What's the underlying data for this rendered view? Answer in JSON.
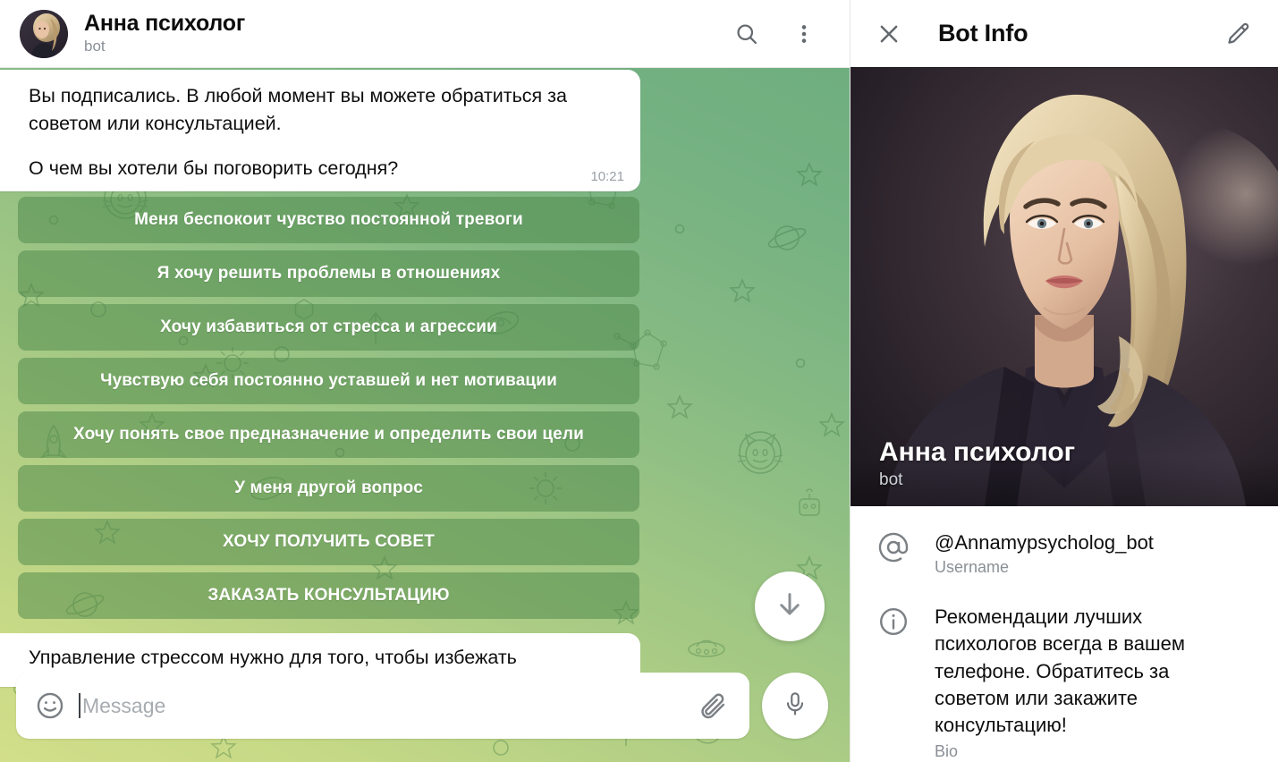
{
  "chat_header": {
    "title": "Анна психолог",
    "subtitle": "bot",
    "avatar_name": "anna-psycholog-avatar",
    "search_icon": "search-icon",
    "menu_icon": "more-vertical-icon"
  },
  "message": {
    "paragraph_1": "Вы подписались. В любой момент вы можете обратиться за советом или консультацией.",
    "paragraph_2": "О чем вы хотели бы поговорить сегодня?",
    "time": "10:21"
  },
  "keyboard": {
    "buttons": [
      {
        "label": "Меня беспокоит чувство постоянной тревоги"
      },
      {
        "label": "Я хочу решить проблемы в отношениях"
      },
      {
        "label": "Хочу избавиться от стресса и агрессии"
      },
      {
        "label": "Чувствую себя постоянно уставшей и нет мотивации"
      },
      {
        "label": "Хочу понять свое предназначение и определить свои цели"
      },
      {
        "label": "У меня другой вопрос"
      },
      {
        "label": "ХОЧУ ПОЛУЧИТЬ СОВЕТ"
      },
      {
        "label": "ЗАКАЗАТЬ КОНСУЛЬТАЦИЮ"
      }
    ]
  },
  "next_message_preview": {
    "text": "Управление стрессом нужно для того, чтобы избежать"
  },
  "scroll_button": {
    "icon": "arrow-down-icon"
  },
  "composer": {
    "emoji_icon": "smiley-icon",
    "placeholder": "Message",
    "value": "",
    "attach_icon": "paperclip-icon",
    "mic_icon": "microphone-icon"
  },
  "info_panel": {
    "close_icon": "close-icon",
    "title": "Bot Info",
    "edit_icon": "pencil-icon",
    "photo_name": "Анна психолог",
    "photo_sub": "bot",
    "rows": [
      {
        "icon": "at-sign-icon",
        "value": "@Annamypsycholog_bot",
        "label": "Username"
      },
      {
        "icon": "info-circle-icon",
        "value": "Рекомендации лучших психологов всегда в вашем телефоне. Обратитесь за советом или закажите консультацию!",
        "label": "Bio"
      }
    ]
  },
  "colors": {
    "wallpaper_top": "#6fae7f",
    "wallpaper_bottom": "#d2de8a",
    "keyboard_button": "#4a8648",
    "bubble_bg": "#ffffff",
    "text_primary": "#0e0e0e",
    "text_muted": "#8a9096"
  }
}
